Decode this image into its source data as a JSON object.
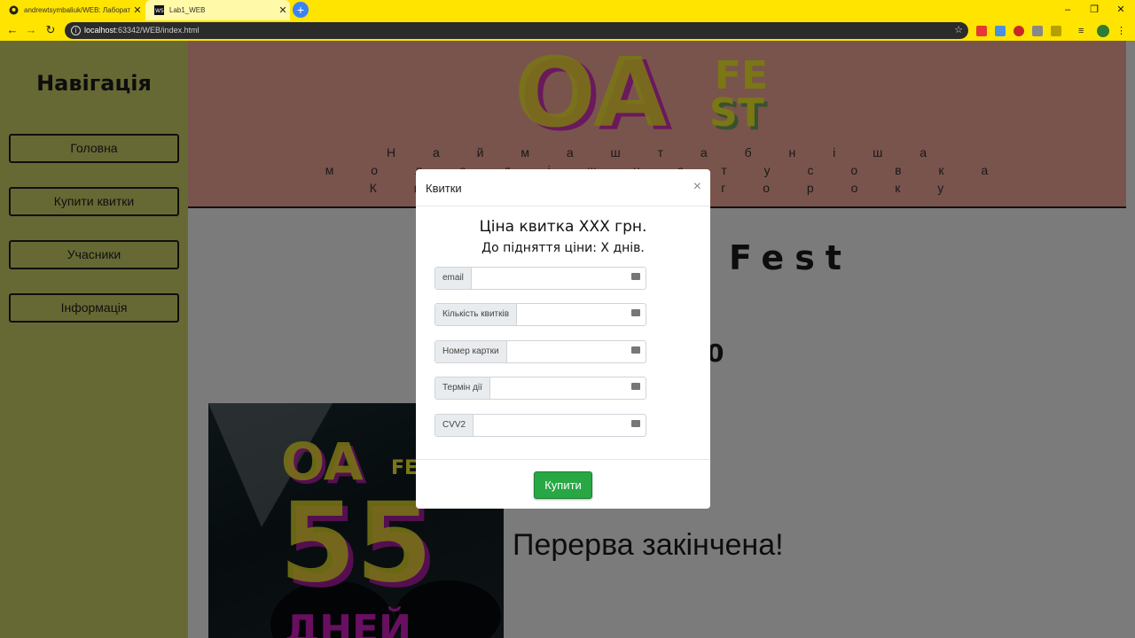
{
  "browser": {
    "tabs": [
      {
        "title": "andrewtsymbaliuk/WEB: Лаборат",
        "active": false
      },
      {
        "title": "Lab1_WEB",
        "active": true
      }
    ],
    "url_host": "localhost",
    "url_rest": ":63342/WEB/index.html"
  },
  "sidebar": {
    "title": "Навігація",
    "items": [
      "Головна",
      "Купити квитки",
      "Учасники",
      "Інформація"
    ]
  },
  "header": {
    "logo": {
      "big": "OA",
      "small_top": "FE",
      "small_bottom": "ST"
    },
    "tagline_lines": [
      "Н а й м а ш т а б н і ш а",
      "м о л о д і ж н а т у с о в к а",
      "К и є в а ц ь о г о р о к у"
    ]
  },
  "main": {
    "fest_text": "Fest",
    "partial_number": "0",
    "pause_text": "Перерва закінчена!",
    "poster": {
      "logo_big": "OA",
      "logo_small": "FE ST",
      "number": "55",
      "subtext": "ДНЕЙ"
    }
  },
  "modal": {
    "title": "Квитки",
    "close": "×",
    "price_text": "Ціна квитка XXX грн.",
    "until_text": "До підняття ціни: X днів.",
    "fields": [
      {
        "label": "email",
        "value": ""
      },
      {
        "label": "Кількість квитків",
        "value": ""
      },
      {
        "label": "Номер картки",
        "value": ""
      },
      {
        "label": "Термін дії",
        "value": ""
      },
      {
        "label": "CVV2",
        "value": ""
      }
    ],
    "buy_label": "Купити"
  },
  "colors": {
    "chrome": "#ffe400",
    "sidebar": "#cfd26a",
    "header": "#f2a998",
    "accent_green": "#28a745",
    "logo_yellow": "#f5ee2a",
    "logo_magenta": "#d01fc0"
  }
}
